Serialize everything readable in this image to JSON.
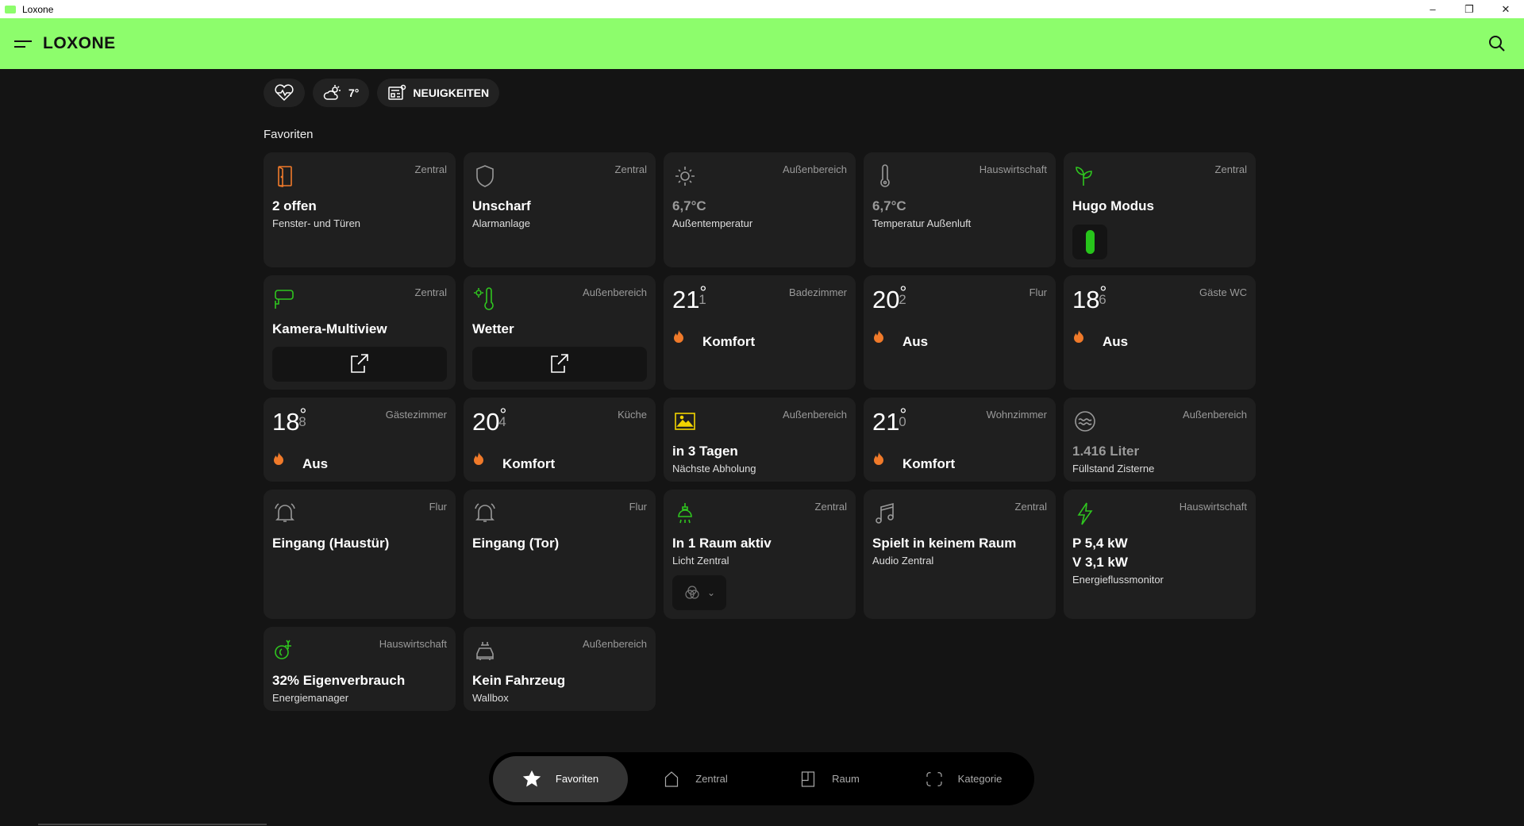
{
  "window": {
    "title": "Loxone",
    "minimize": "–",
    "restore": "❐",
    "close": "✕"
  },
  "header": {
    "logo": "LOXONE"
  },
  "pills": {
    "weather_temp": "7°",
    "news": "NEUIGKEITEN"
  },
  "section_title": "Favoriten",
  "colors": {
    "brand": "#8dfd6c",
    "icon_green": "#2fc61f",
    "orange": "#f07a2a",
    "yellow": "#f2d400"
  },
  "cards": [
    {
      "type": "status",
      "icon": "door-icon",
      "iconColor": "#f07a2a",
      "room": "Zentral",
      "title": "2 offen",
      "sub": "Fenster- und Türen"
    },
    {
      "type": "status",
      "icon": "shield-icon",
      "iconColor": "#999",
      "room": "Zentral",
      "title": "Unscharf",
      "sub": "Alarmanlage"
    },
    {
      "type": "status",
      "icon": "sun-icon",
      "iconColor": "#999",
      "room": "Außenbereich",
      "title": "6,7°C",
      "sub": "Außentemperatur",
      "dim": true
    },
    {
      "type": "status",
      "icon": "thermometer-icon",
      "iconColor": "#999",
      "room": "Hauswirtschaft",
      "title": "6,7°C",
      "sub": "Temperatur Außenluft",
      "dim": true
    },
    {
      "type": "toggle",
      "icon": "plant-icon",
      "iconColor": "#2fc61f",
      "room": "Zentral",
      "title": "Hugo Modus",
      "on": true
    },
    {
      "type": "link",
      "icon": "camera-icon",
      "iconColor": "#2fc61f",
      "room": "Zentral",
      "title": "Kamera-Multiview"
    },
    {
      "type": "link",
      "icon": "weather-icon",
      "iconColor": "#2fc61f",
      "room": "Außenbereich",
      "title": "Wetter"
    },
    {
      "type": "temp",
      "room": "Badezimmer",
      "int": "21",
      "dec": "1",
      "state": "Komfort"
    },
    {
      "type": "temp",
      "room": "Flur",
      "int": "20",
      "dec": "2",
      "state": "Aus"
    },
    {
      "type": "temp",
      "room": "Gäste WC",
      "int": "18",
      "dec": "6",
      "state": "Aus"
    },
    {
      "type": "temp",
      "room": "Gästezimmer",
      "int": "18",
      "dec": "8",
      "state": "Aus"
    },
    {
      "type": "temp",
      "room": "Küche",
      "int": "20",
      "dec": "4",
      "state": "Komfort"
    },
    {
      "type": "status",
      "icon": "calendar-image-icon",
      "iconColor": "#f2d400",
      "room": "Außenbereich",
      "title": "in 3 Tagen",
      "sub": "Nächste Abholung"
    },
    {
      "type": "temp",
      "room": "Wohnzimmer",
      "int": "21",
      "dec": "0",
      "state": "Komfort"
    },
    {
      "type": "status",
      "icon": "water-tank-icon",
      "iconColor": "#999",
      "room": "Außenbereich",
      "title": "1.416 Liter",
      "sub": "Füllstand Zisterne",
      "dim": true
    },
    {
      "type": "status",
      "icon": "bell-icon",
      "iconColor": "#999",
      "room": "Flur",
      "title": "Eingang (Haustür)"
    },
    {
      "type": "status",
      "icon": "bell-icon",
      "iconColor": "#999",
      "room": "Flur",
      "title": "Eingang (Tor)"
    },
    {
      "type": "light",
      "icon": "lamp-icon",
      "iconColor": "#2fc61f",
      "room": "Zentral",
      "title": "In 1 Raum aktiv",
      "sub": "Licht Zentral"
    },
    {
      "type": "status",
      "icon": "music-icon",
      "iconColor": "#999",
      "room": "Zentral",
      "title": "Spielt in keinem Raum",
      "sub": "Audio Zentral"
    },
    {
      "type": "energy",
      "icon": "lightning-icon",
      "iconColor": "#2fc61f",
      "room": "Hauswirtschaft",
      "title": "P 5,4 kW",
      "title2": "V 3,1 kW",
      "sub": "Energieflussmonitor"
    },
    {
      "type": "status",
      "icon": "eco-plug-icon",
      "iconColor": "#2fc61f",
      "room": "Hauswirtschaft",
      "title": "32% Eigenverbrauch",
      "sub": "Energiemanager"
    },
    {
      "type": "status",
      "icon": "car-charger-icon",
      "iconColor": "#999",
      "room": "Außenbereich",
      "title": "Kein Fahrzeug",
      "sub": "Wallbox"
    }
  ],
  "nav": [
    {
      "label": "Favoriten",
      "icon": "star-icon",
      "active": true
    },
    {
      "label": "Zentral",
      "icon": "house-icon"
    },
    {
      "label": "Raum",
      "icon": "room-icon"
    },
    {
      "label": "Kategorie",
      "icon": "category-icon"
    }
  ]
}
